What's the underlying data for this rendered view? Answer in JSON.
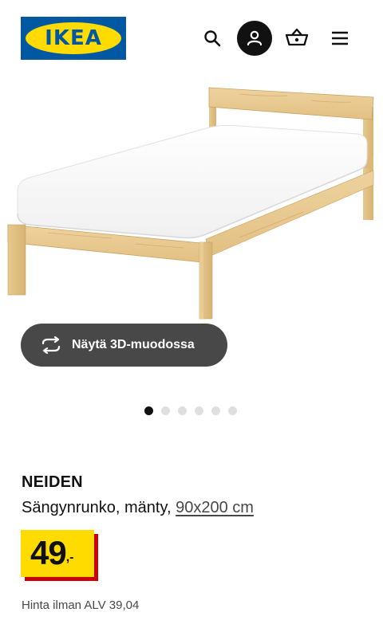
{
  "header": {
    "logo_text": "IKEA",
    "icons": [
      "search-icon",
      "profile-icon",
      "cart-icon",
      "menu-icon"
    ],
    "brand_blue": "#0058a3",
    "brand_yellow": "#ffdb00"
  },
  "media": {
    "view_3d_label": "Näytä 3D-muodossa",
    "view_3d_icon": "rotate-3d-icon",
    "carousel": {
      "total": 6,
      "active": 1
    }
  },
  "product": {
    "name": "NEIDEN",
    "description": "Sängynrunko, mänty,",
    "size_link": "90x200 cm",
    "price_integer": "49",
    "price_suffix": ",-",
    "price_accent": "#cc0008",
    "vat_text": "Hinta ilman ALV 39,04"
  }
}
